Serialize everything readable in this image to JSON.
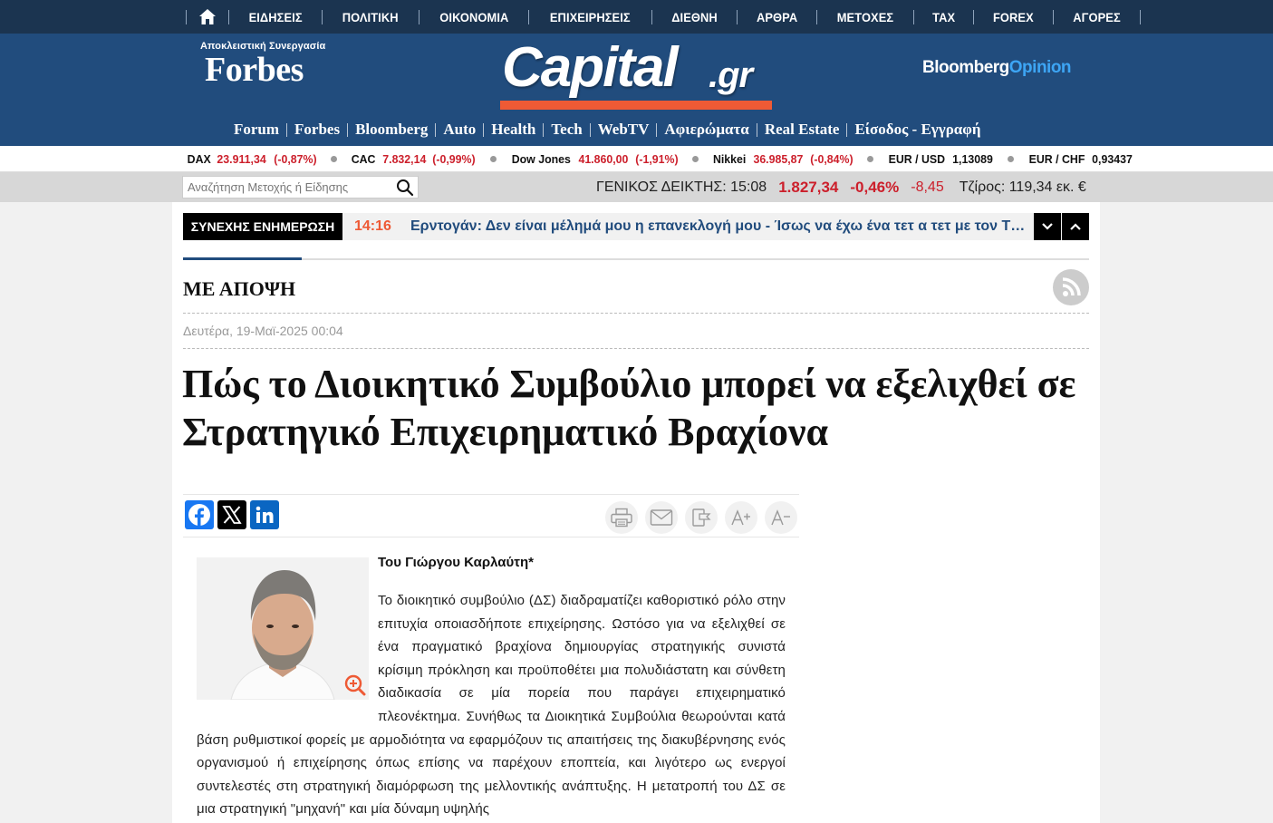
{
  "topnav": {
    "items": [
      "ΕΙΔΗΣΕΙΣ",
      "ΠΟΛΙΤΙΚΗ",
      "ΟΙΚΟΝΟΜΙΑ",
      "ΕΠΙΧΕΙΡΗΣΕΙΣ",
      "ΔΙΕΘΝΗ",
      "ΑΡΘΡΑ",
      "ΜΕΤΟΧΕΣ",
      "TAX",
      "FOREX",
      "ΑΓΟΡΕΣ"
    ]
  },
  "masthead": {
    "forbes_caption": "Αποκλειστική Συνεργασία",
    "forbes_name": "Forbes",
    "logo_word": "Capital",
    "logo_tld": ".gr",
    "bloomberg_a": "Bloomberg",
    "bloomberg_b": "Opinion"
  },
  "subnav": {
    "items": [
      "Forum",
      "Forbes",
      "Bloomberg",
      "Auto",
      "Health",
      "Tech",
      "WebTV",
      "Αφιερώματα",
      "Real Estate",
      "Είσοδος - Εγγραφή"
    ]
  },
  "ticker": [
    {
      "name": "DAX",
      "value": "23.911,34",
      "change": "(-0,87%)"
    },
    {
      "name": "CAC",
      "value": "7.832,14",
      "change": "(-0,99%)"
    },
    {
      "name": "Dow Jones",
      "value": "41.860,00",
      "change": "(-1,91%)"
    },
    {
      "name": "Nikkei",
      "value": "36.985,87",
      "change": "(-0,84%)"
    },
    {
      "name": "EUR / USD",
      "value": "1,13089",
      "change": ""
    },
    {
      "name": "EUR / CHF",
      "value": "0,93437",
      "change": ""
    }
  ],
  "search": {
    "placeholder": "Αναζήτηση Μετοχής ή Είδησης"
  },
  "general_index": {
    "label": "ΓΕΝΙΚΟΣ ΔΕΙΚΤΗΣ: 15:08",
    "price": "1.827,34",
    "pct": "-0,46%",
    "change": "-8,45",
    "volume": "Τζίρος: 119,34 εκ. €"
  },
  "breaking": {
    "tag": "ΣΥΝΕΧΗΣ ΕΝΗΜΕΡΩΣΗ",
    "time": "14:16",
    "headline": "Ερντογάν: Δεν είναι μέλημά μου η επανεκλογή μου - Ίσως να έχω ένα τετ α τετ με τον Τραμπ"
  },
  "article": {
    "section": "ΜΕ ΑΠΟΨΗ",
    "date": "Δευτέρα, 19-Μαϊ-2025 00:04",
    "title": "Πώς το Διοικητικό Συμβούλιο μπορεί να εξελιχθεί σε Στρατηγικό Επιχειρηματικό Βραχίονα",
    "byline": "Του Γιώργου Καρλαύτη*",
    "body": "Το διοικητικό συμβούλιο (ΔΣ) διαδραματίζει καθοριστικό ρόλο στην επιτυχία οποιασδήποτε επιχείρησης. Ωστόσο για να εξελιχθεί σε ένα πραγματικό βραχίονα δημιουργίας στρατηγικής συνιστά κρίσιμη πρόκληση και προϋποθέτει μια πολυδιάστατη και σύνθετη διαδικασία σε μία πορεία που παράγει επιχειρηματικό πλεονέκτημα. Συνήθως τα Διοικητικά Συμβούλια θεωρούνται κατά βάση ρυθμιστικοί φορείς με αρμοδιότητα να εφαρμόζουν τις απαιτήσεις της διακυβέρνησης ενός οργανισμού ή επιχείρησης όπως επίσης να παρέχουν εποπτεία, και λιγότερο ως ενεργοί συντελεστές στη στρατηγική διαμόρφωση της μελλοντικής ανάπτυξης. Η μετατροπή του ΔΣ σε μια στρατηγική \"μηχανή\" και μία δύναμη υψηλής"
  },
  "colors": {
    "navy": "#1b3450",
    "masthead": "#214c7d",
    "accent_orange": "#ee5a35",
    "down_red": "#cc1f2b"
  }
}
